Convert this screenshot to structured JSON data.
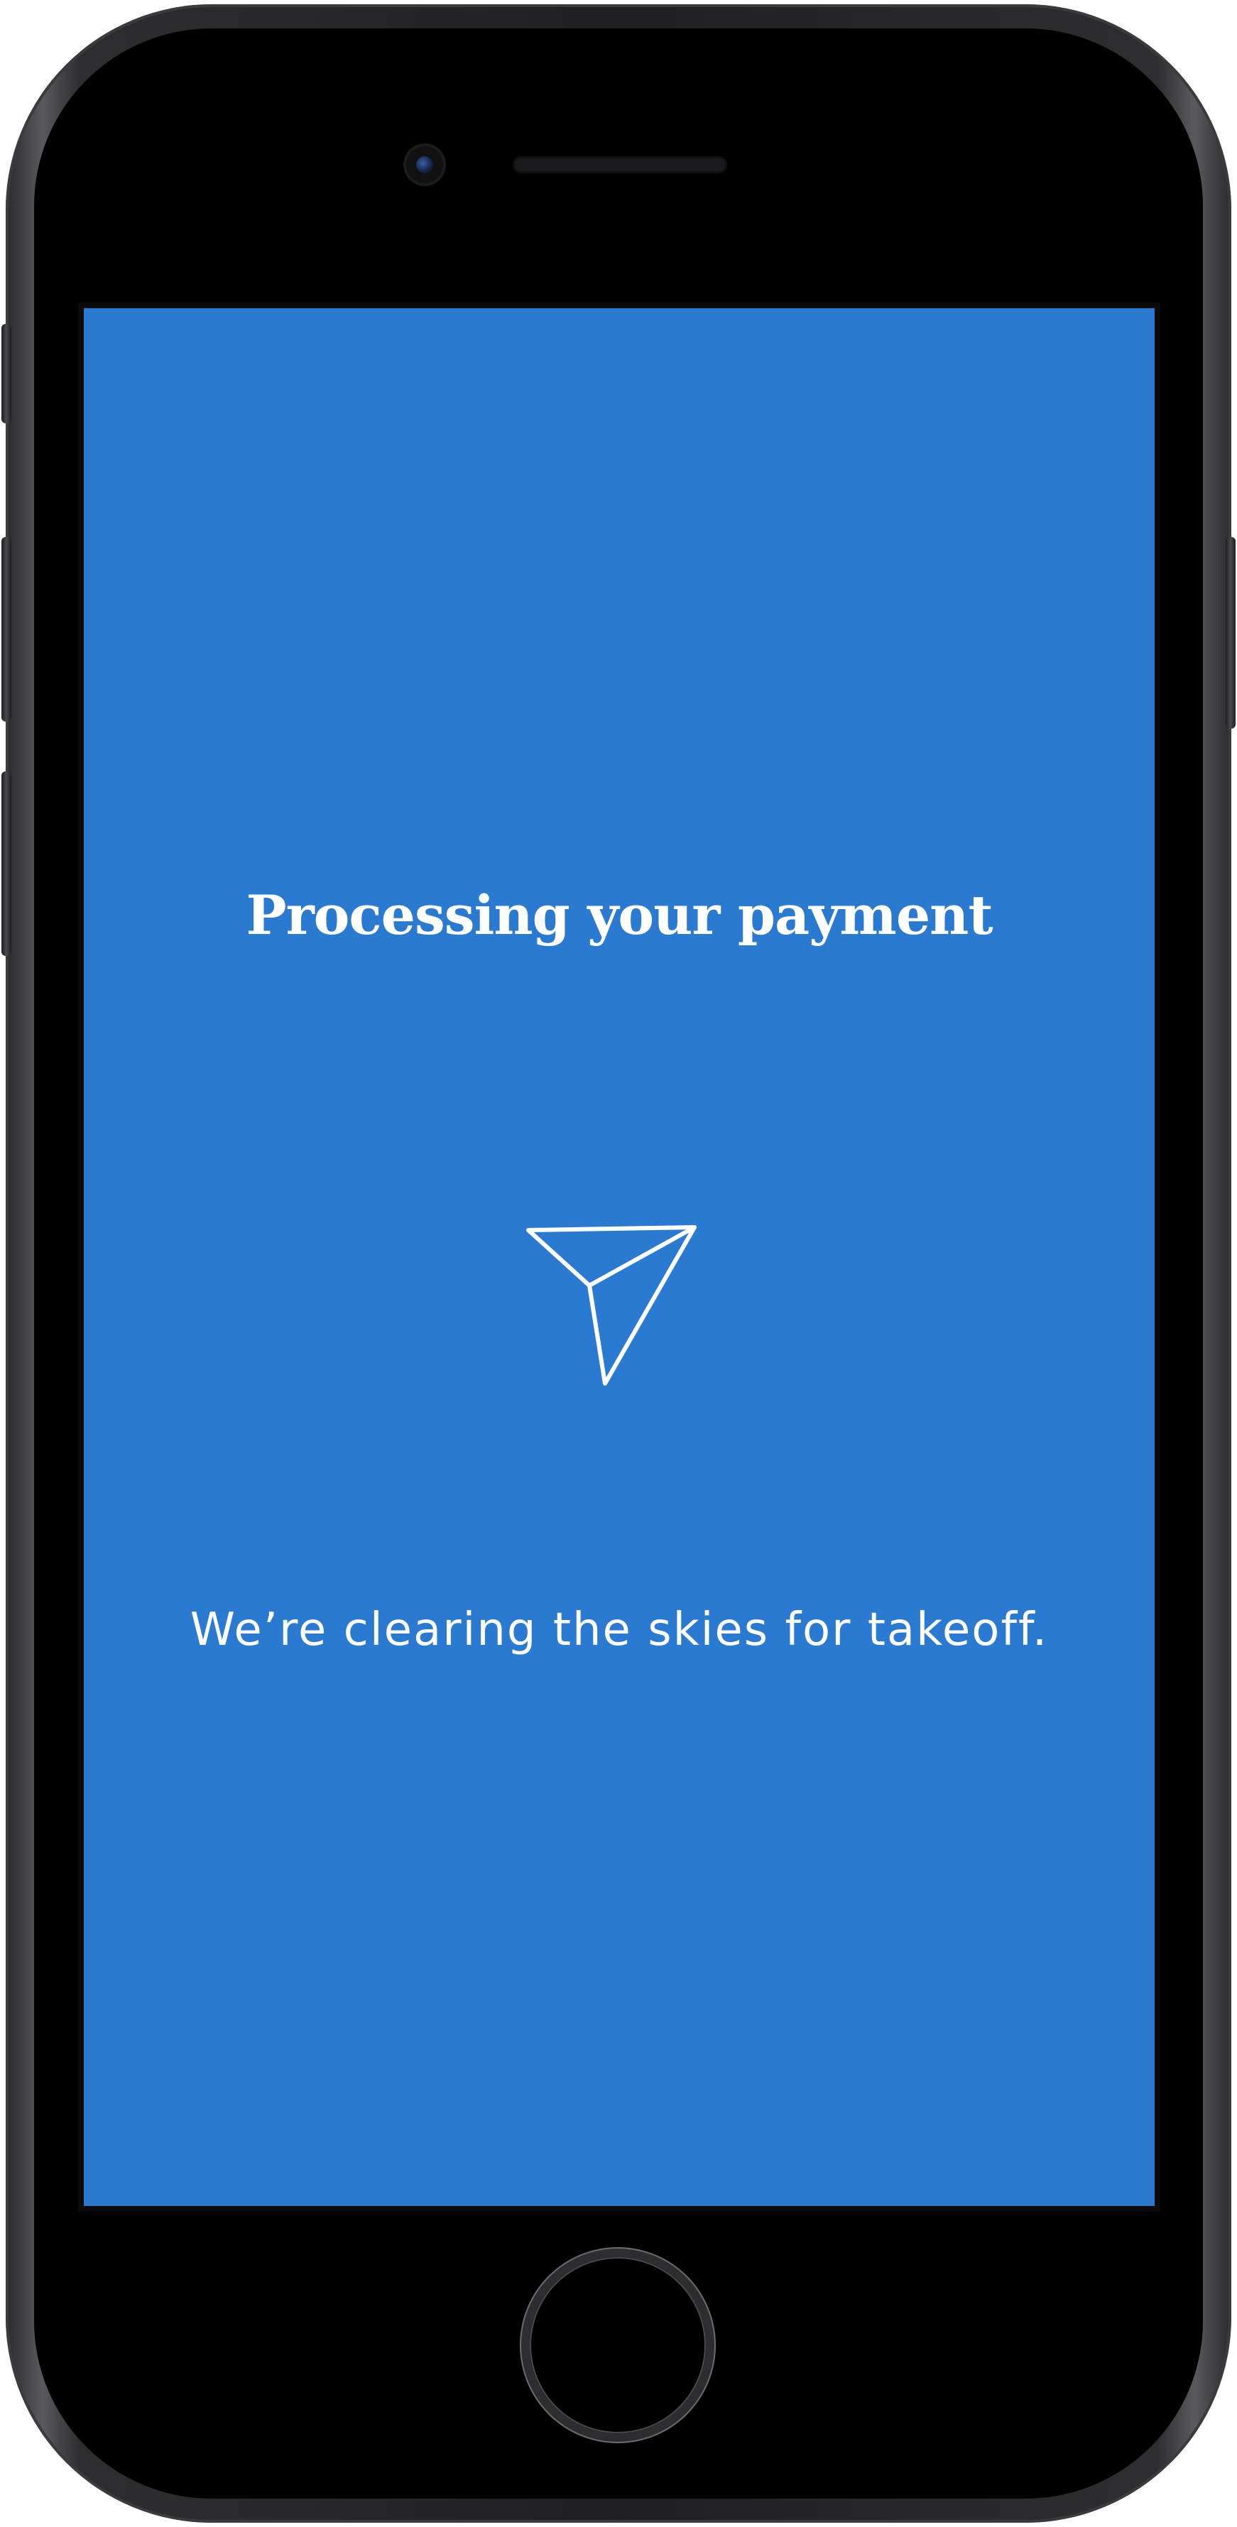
{
  "screen": {
    "title": "Processing your payment",
    "message": "We’re clearing the skies for takeoff.",
    "background_color": "#2b7ad2",
    "text_color": "#ffffff",
    "icon": "paper-plane-icon"
  },
  "device": {
    "frame_color": "#1f1f21",
    "bezel_color": "#000000"
  }
}
